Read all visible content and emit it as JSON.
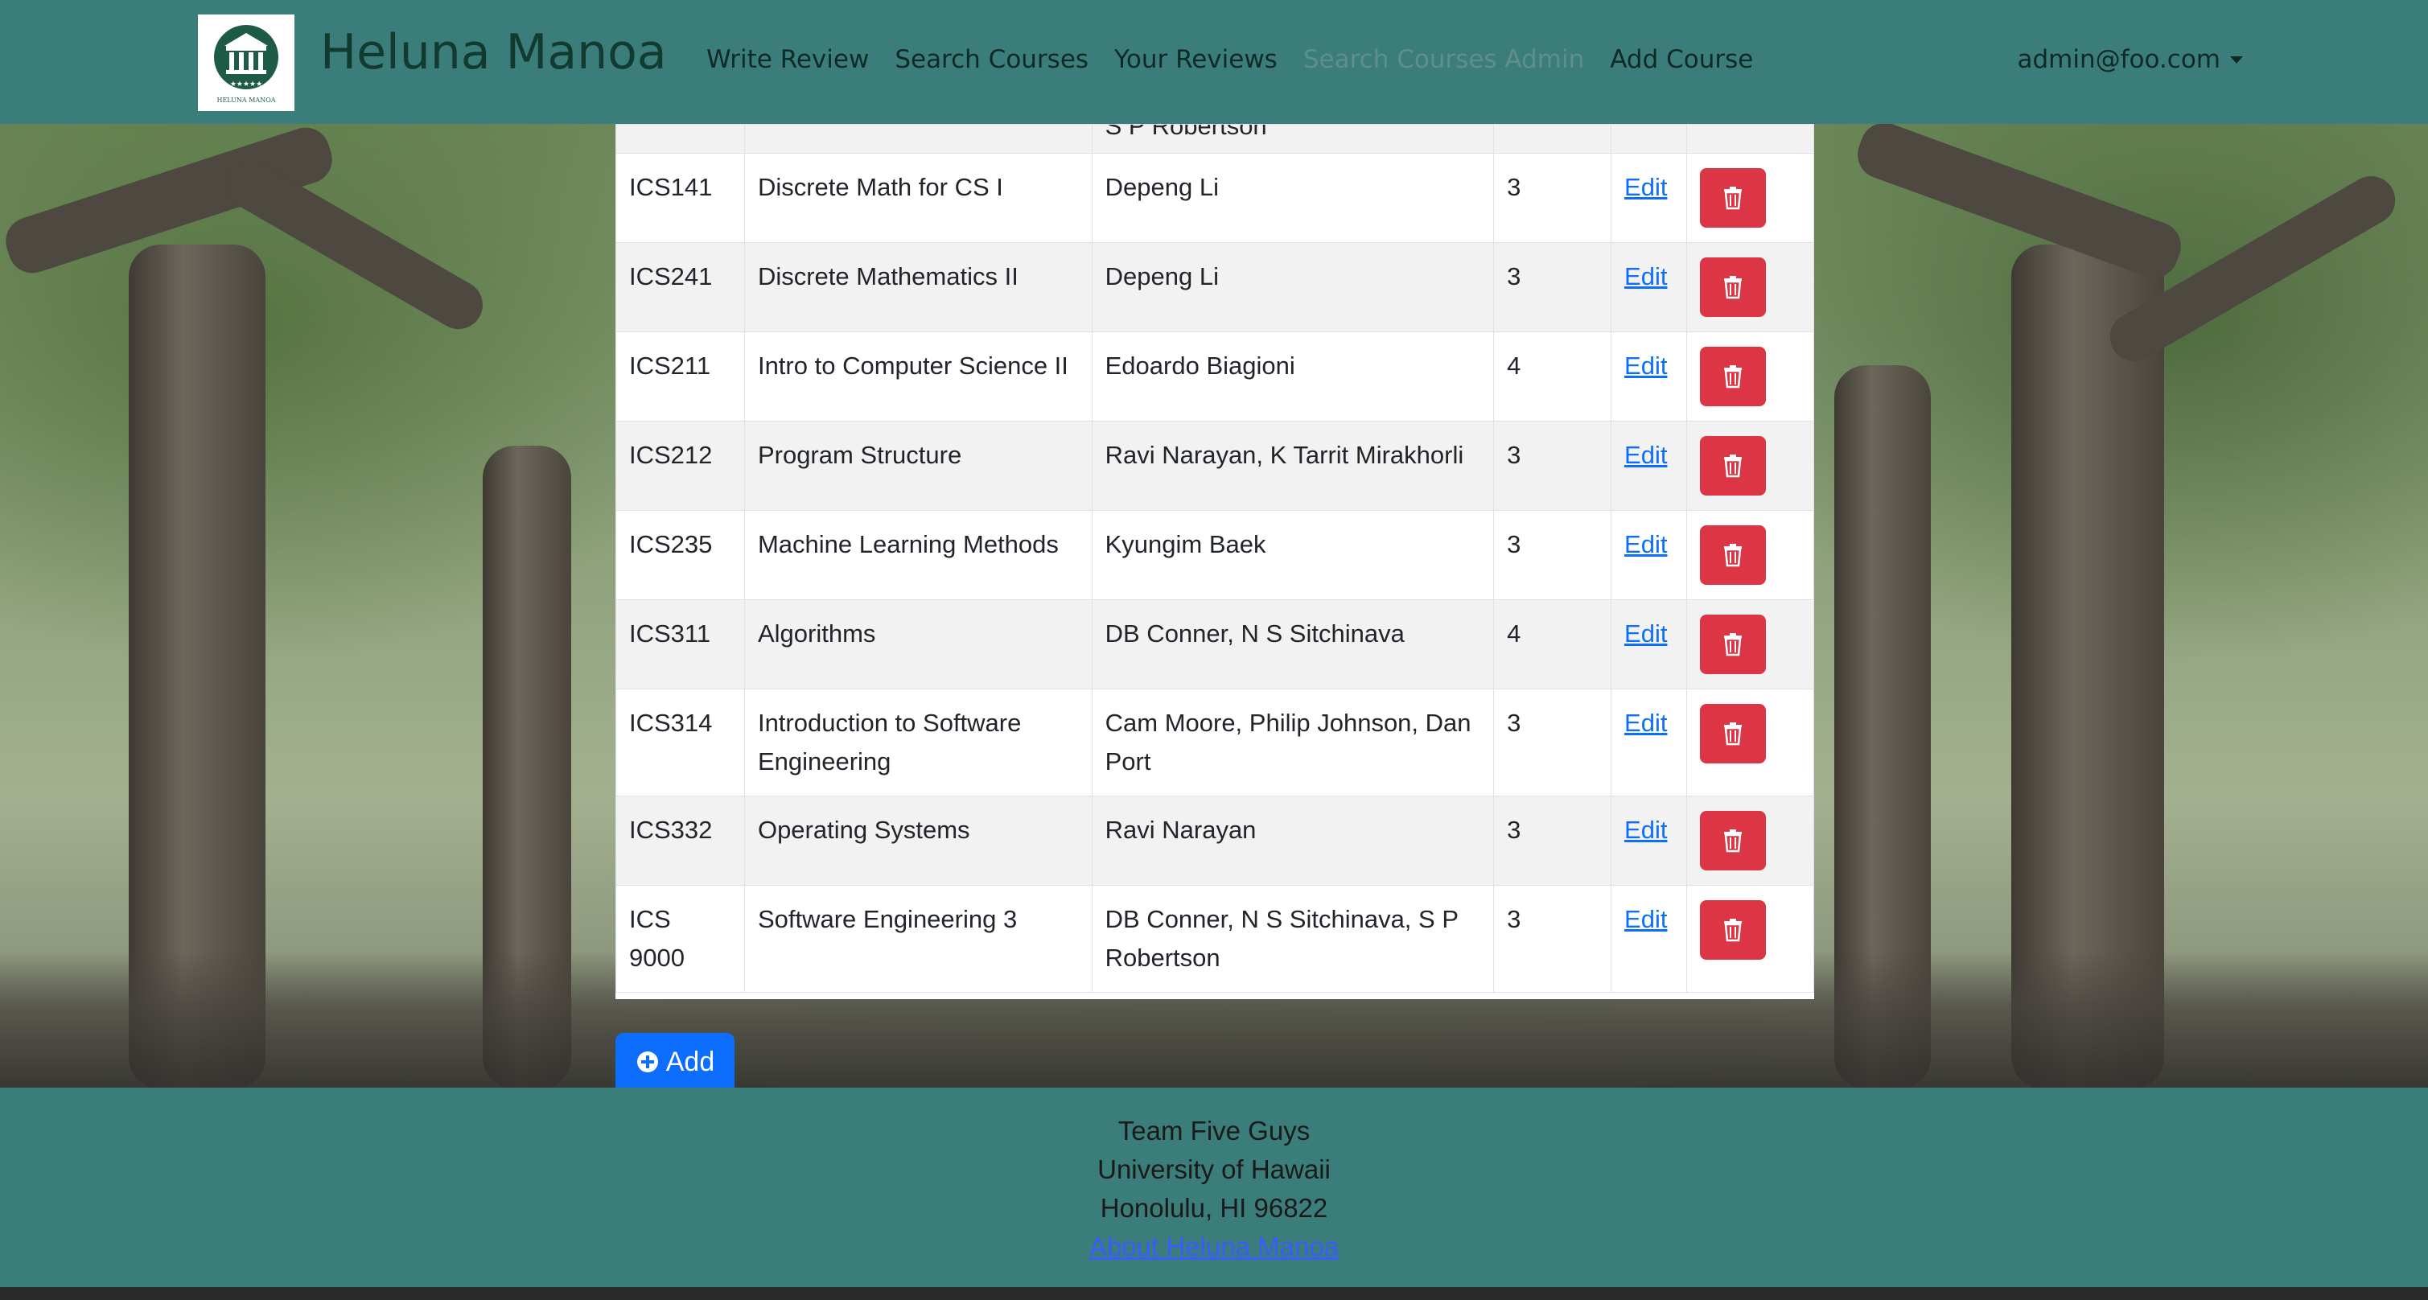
{
  "navbar": {
    "brand": "Heluna Manoa",
    "logo_text": "HELUNA MANOA",
    "links": [
      "Write Review",
      "Search Courses",
      "Your Reviews",
      "Search Courses Admin",
      "Add Course"
    ],
    "user": "admin@foo.com"
  },
  "table": {
    "partial_row_instructor": "S P Robertson",
    "edit_label": "Edit",
    "rows": [
      {
        "code": "ICS141",
        "name": "Discrete Math for CS I",
        "instructors": "Depeng Li",
        "credits": "3"
      },
      {
        "code": "ICS241",
        "name": "Discrete Mathematics II",
        "instructors": "Depeng Li",
        "credits": "3"
      },
      {
        "code": "ICS211",
        "name": "Intro to Computer Science II",
        "instructors": "Edoardo Biagioni",
        "credits": "4"
      },
      {
        "code": "ICS212",
        "name": "Program Structure",
        "instructors": "Ravi Narayan, K Tarrit Mirakhorli",
        "credits": "3"
      },
      {
        "code": "ICS235",
        "name": "Machine Learning Methods",
        "instructors": "Kyungim Baek",
        "credits": "3"
      },
      {
        "code": "ICS311",
        "name": "Algorithms",
        "instructors": "DB Conner, N S Sitchinava",
        "credits": "4"
      },
      {
        "code": "ICS314",
        "name": "Introduction to Software Engineering",
        "instructors": "Cam Moore, Philip Johnson, Dan Port",
        "credits": "3"
      },
      {
        "code": "ICS332",
        "name": "Operating Systems",
        "instructors": "Ravi Narayan",
        "credits": "3"
      },
      {
        "code": "ICS 9000",
        "name": "Software Engineering 3",
        "instructors": "DB Conner, N S Sitchinava, S P Robertson",
        "credits": "3"
      }
    ]
  },
  "add_button": {
    "label": "Add",
    "icon": "plus-circle-icon"
  },
  "footer": {
    "team": "Team Five Guys",
    "university": "University of Hawaii",
    "location": "Honolulu, HI 96822",
    "link": "About Heluna Manoa"
  },
  "colors": {
    "navbar_bg": "#3a7d7b",
    "delete_button": "#dc3545",
    "primary": "#0d6efd"
  }
}
